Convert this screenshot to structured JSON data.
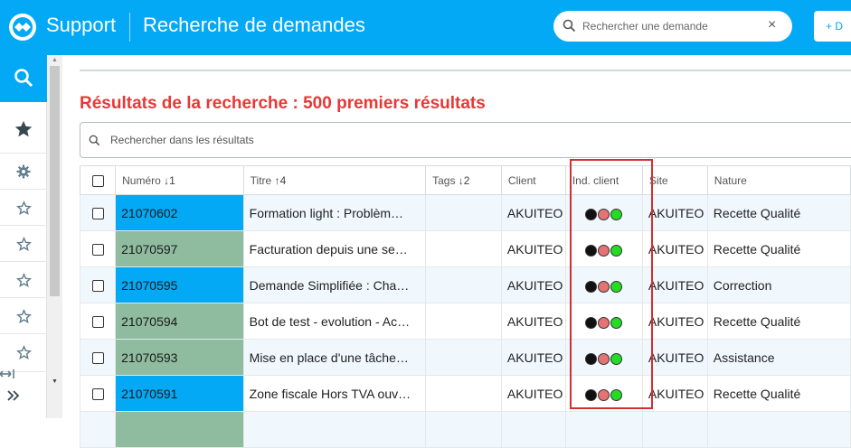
{
  "header": {
    "app_title": "Support",
    "page_title": "Recherche de demandes",
    "search_placeholder": "Rechercher une demande",
    "clear_icon": "×",
    "new_button_label": "+ D"
  },
  "sidebar": {
    "items": [
      {
        "icon": "search-icon"
      },
      {
        "icon": "star-filled-icon"
      },
      {
        "icon": "gear-icon"
      },
      {
        "icon": "star-outline-icon"
      },
      {
        "icon": "star-outline-icon"
      },
      {
        "icon": "star-outline-icon"
      },
      {
        "icon": "star-outline-icon"
      },
      {
        "icon": "star-outline-icon"
      },
      {
        "icon": "expand-width-icon"
      },
      {
        "icon": "double-chevron-right-icon"
      }
    ],
    "expand_glyph": "|↔|",
    "more_glyph": "»"
  },
  "results": {
    "title": "Résultats de la recherche : 500 premiers résultats",
    "search_placeholder": "Rechercher dans les résultats"
  },
  "table": {
    "columns": [
      {
        "label": "",
        "sort": ""
      },
      {
        "label": "Numéro",
        "sort": "↓1"
      },
      {
        "label": "Titre",
        "sort": "↑4"
      },
      {
        "label": "Tags",
        "sort": "↓2"
      },
      {
        "label": "Client",
        "sort": ""
      },
      {
        "label": "Ind. client",
        "sort": ""
      },
      {
        "label": "Site",
        "sort": ""
      },
      {
        "label": "Nature",
        "sort": ""
      }
    ],
    "rows": [
      {
        "numero": "21070602",
        "numero_color": "#03a9f4",
        "titre": "Formation light : Problèm…",
        "tags": "",
        "client": "AKUITEO",
        "site": "AKUITEO",
        "nature": "Recette Qualité"
      },
      {
        "numero": "21070597",
        "numero_color": "#8fbc9f",
        "titre": "Facturation depuis une se…",
        "tags": "",
        "client": "AKUITEO",
        "site": "AKUITEO",
        "nature": "Recette Qualité"
      },
      {
        "numero": "21070595",
        "numero_color": "#03a9f4",
        "titre": "Demande Simplifiée : Cha…",
        "tags": "",
        "client": "AKUITEO",
        "site": "AKUITEO",
        "nature": "Correction"
      },
      {
        "numero": "21070594",
        "numero_color": "#8fbc9f",
        "titre": "Bot de test - evolution - Ac…",
        "tags": "",
        "client": "AKUITEO",
        "site": "AKUITEO",
        "nature": "Recette Qualité"
      },
      {
        "numero": "21070593",
        "numero_color": "#8fbc9f",
        "titre": "Mise en place d'une tâche…",
        "tags": "",
        "client": "AKUITEO",
        "site": "AKUITEO",
        "nature": "Assistance"
      },
      {
        "numero": "21070591",
        "numero_color": "#03a9f4",
        "titre": "Zone fiscale Hors TVA ouv…",
        "tags": "",
        "client": "AKUITEO",
        "site": "AKUITEO",
        "nature": "Recette Qualité"
      },
      {
        "numero": "",
        "numero_color": "#8fbc9f",
        "titre": "",
        "tags": "",
        "client": "",
        "site": "",
        "nature": ""
      }
    ],
    "indicator_colors": [
      "#111111",
      "#e57373",
      "#22dd22"
    ]
  },
  "colors": {
    "accent": "#03a9f4",
    "results_title": "#e53935",
    "highlight_box": "#d32f2f"
  }
}
